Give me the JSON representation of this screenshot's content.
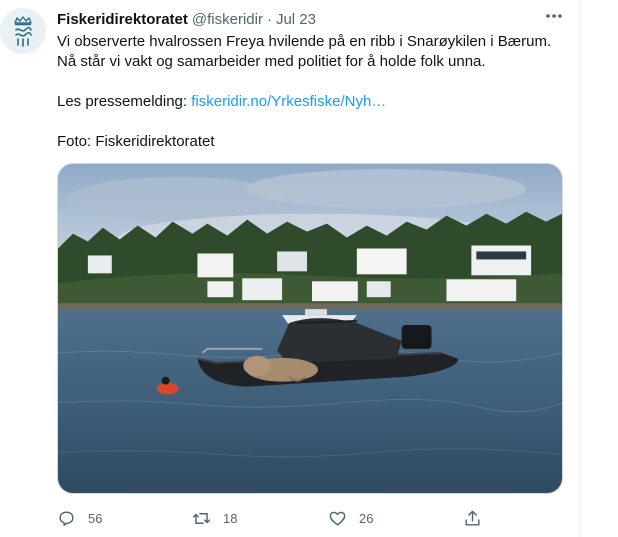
{
  "tweet": {
    "display_name": "Fiskeridirektoratet",
    "handle": "@fiskeridir",
    "separator": "·",
    "date": "Jul 23",
    "text_line1": "Vi observerte hvalrossen Freya hvilende på en ribb i Snarøykilen i Bærum.",
    "text_line2": "Nå står vi vakt og samarbeider med politiet for å holde folk unna.",
    "press_prefix": "Les pressemelding: ",
    "press_link": "fiskeridir.no/Yrkesfiske/Nyh…",
    "photo_credit": "Foto: Fiskeridirektoratet"
  },
  "actions": {
    "reply_count": "56",
    "retweet_count": "18",
    "like_count": "26"
  },
  "icons": {
    "avatar": "fiskeridir-crown-logo",
    "more": "more-dots-icon",
    "reply": "reply-icon",
    "retweet": "retweet-icon",
    "like": "heart-icon",
    "share": "share-icon"
  },
  "colors": {
    "text": "#0f1419",
    "secondary": "#536471",
    "link": "#1d9bf0",
    "avatar_mark": "#2a6d8a"
  }
}
